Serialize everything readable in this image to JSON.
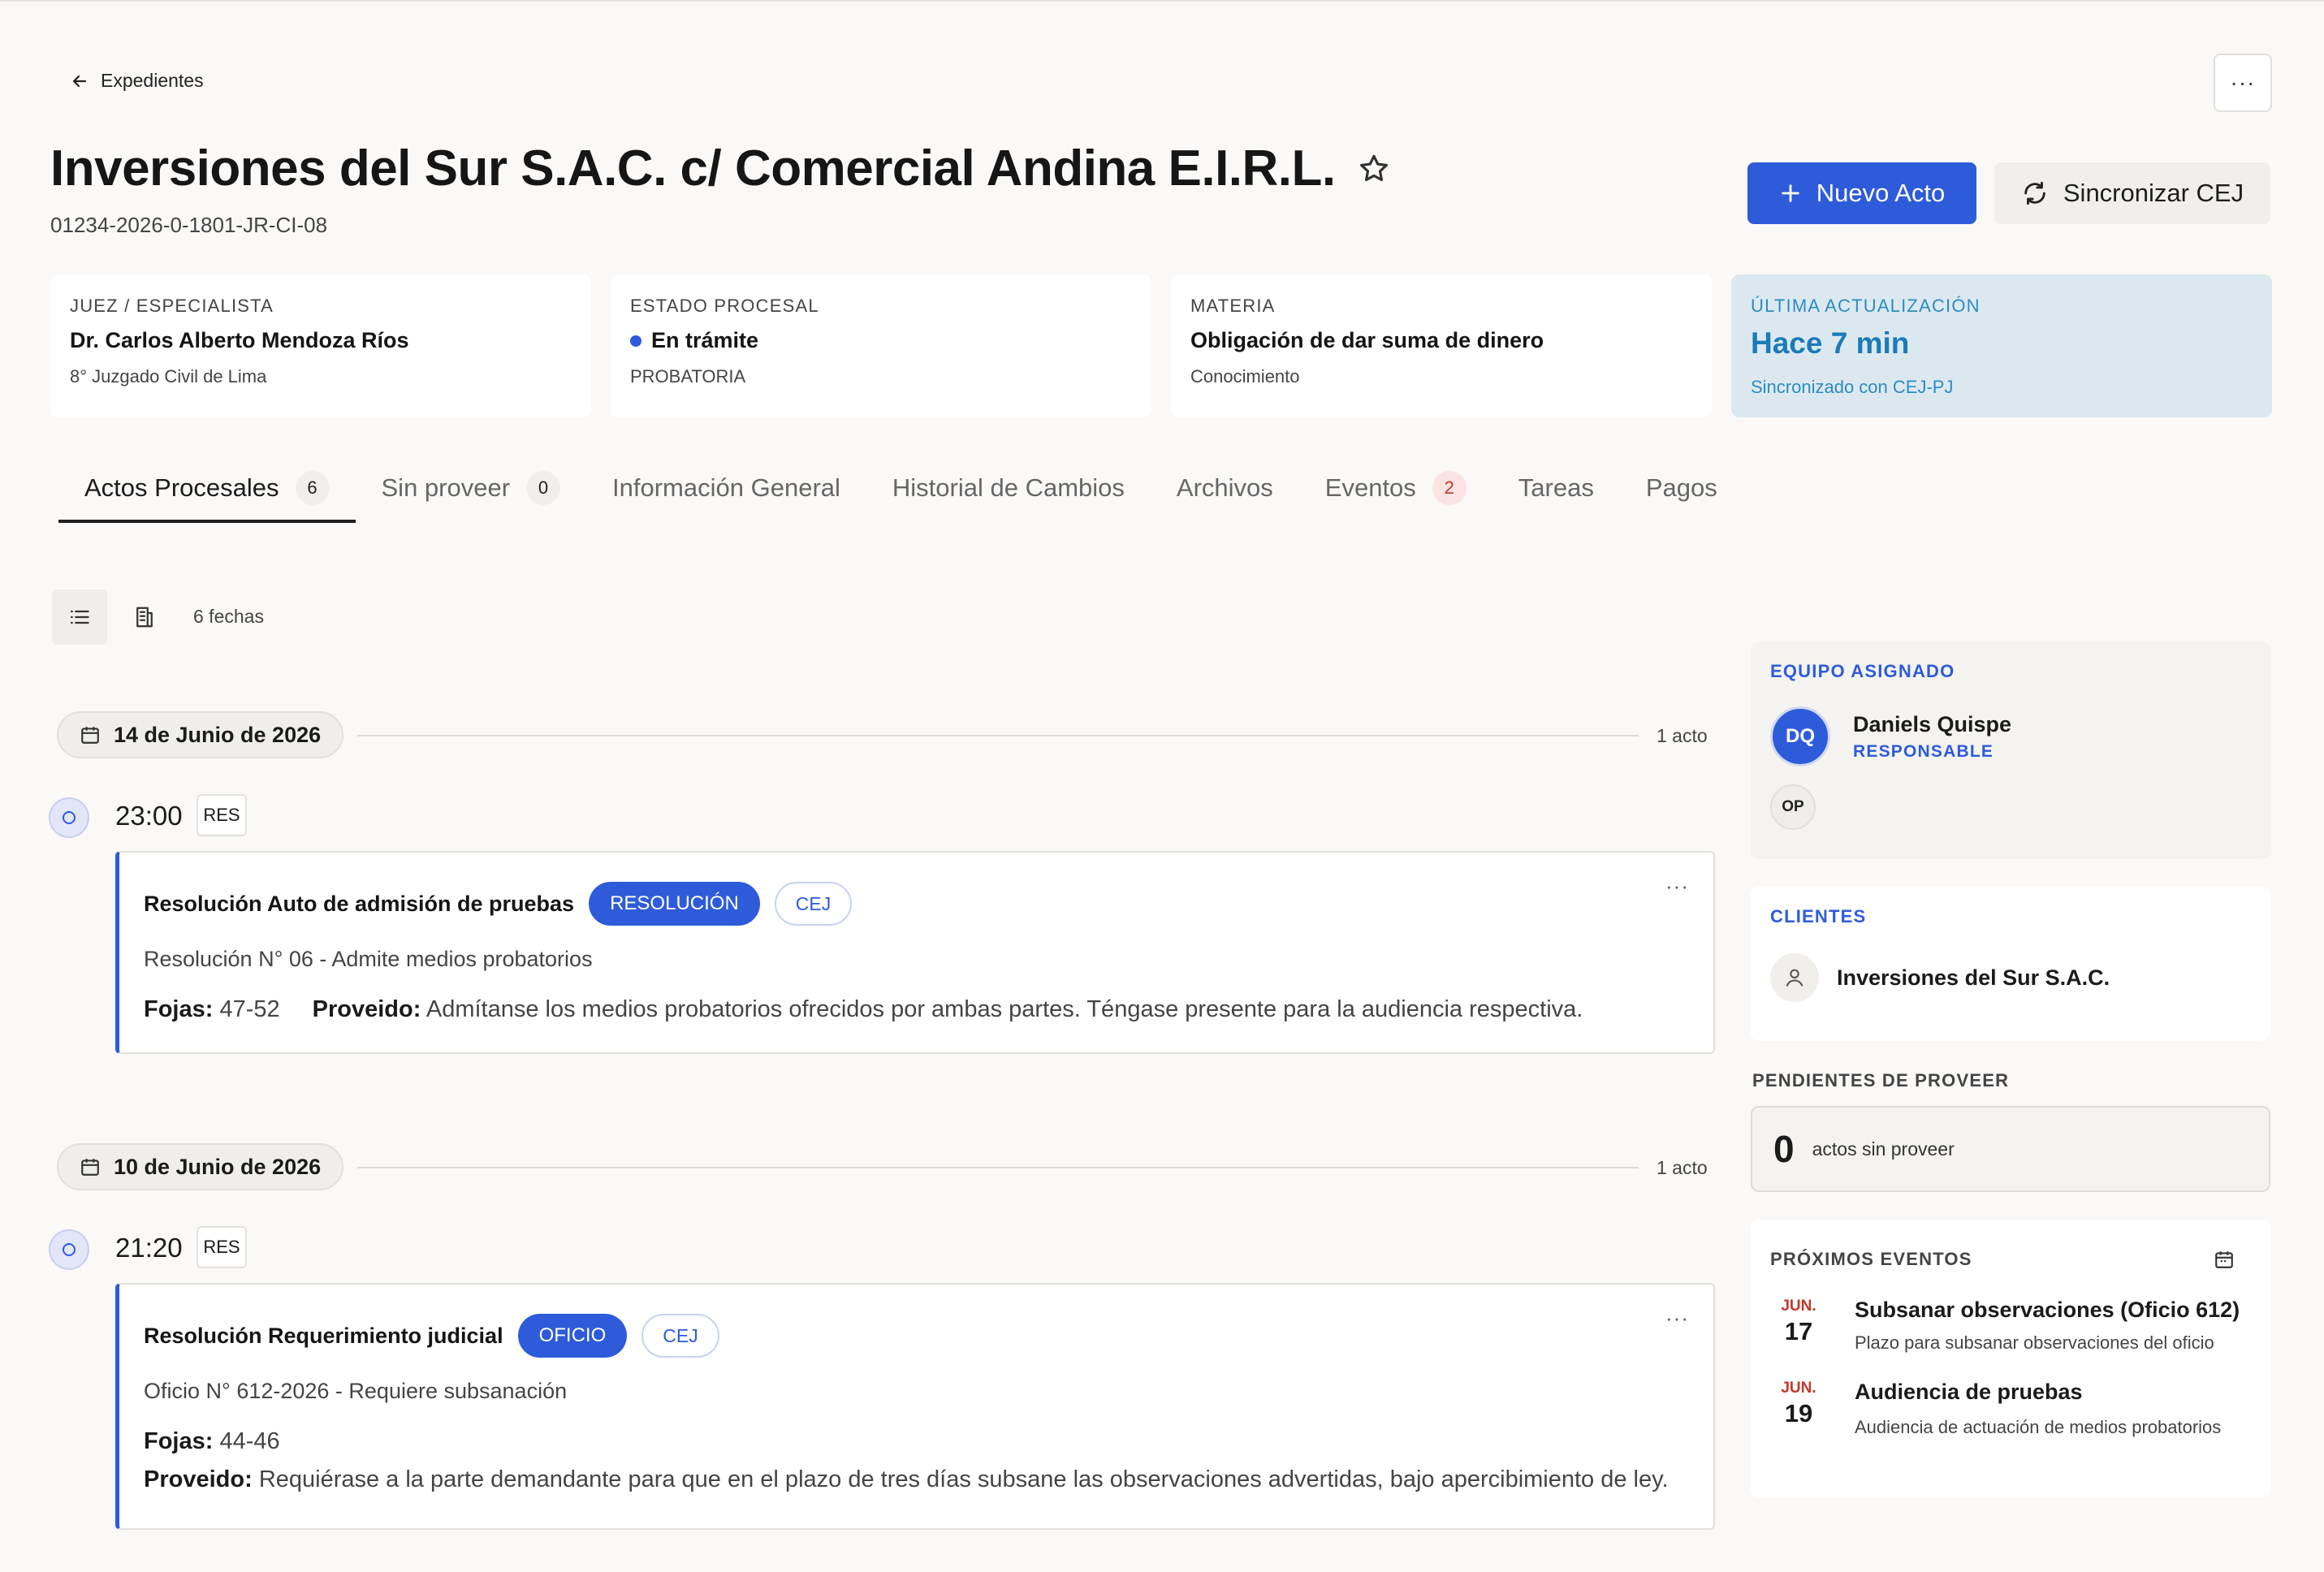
{
  "header": {
    "back_label": "Expedientes",
    "title": "Inversiones del Sur S.A.C. c/ Comercial Andina E.I.R.L.",
    "case_number": "01234-2026-0-1801-JR-CI-08",
    "more_label": "···",
    "new_act_label": "Nuevo Acto",
    "sync_label": "Sincronizar CEJ"
  },
  "info_cards": {
    "judge": {
      "label": "JUEZ / ESPECIALISTA",
      "value": "Dr. Carlos Alberto Mendoza Ríos",
      "sub": "8° Juzgado Civil de Lima"
    },
    "state": {
      "label": "ESTADO PROCESAL",
      "value": "En trámite",
      "sub": "PROBATORIA",
      "dot_color": "#2e5bd9"
    },
    "matter": {
      "label": "MATERIA",
      "value": "Obligación de dar suma de dinero",
      "sub": "Conocimiento"
    },
    "update": {
      "label": "ÚLTIMA ACTUALIZACIÓN",
      "value": "Hace 7 min",
      "sub": "Sincronizado con CEJ-PJ"
    }
  },
  "tabs": [
    {
      "label": "Actos Procesales",
      "badge": "6"
    },
    {
      "label": "Sin proveer",
      "badge": "0"
    },
    {
      "label": "Información General"
    },
    {
      "label": "Historial de Cambios"
    },
    {
      "label": "Archivos"
    },
    {
      "label": "Eventos",
      "badge": "2"
    },
    {
      "label": "Tareas"
    },
    {
      "label": "Pagos"
    }
  ],
  "toolbar": {
    "count_label": "6 fechas"
  },
  "timeline": [
    {
      "date": "14 de Junio de 2026",
      "count": "1 acto",
      "time": "23:00",
      "tag": "RES",
      "act": {
        "title": "Resolución Auto de admisión de pruebas",
        "type": "RESOLUCIÓN",
        "source": "CEJ",
        "subtitle": "Resolución N° 06 - Admite medios probatorios",
        "fojas_label": "Fojas:",
        "fojas": "47-52",
        "proveido_label": "Proveido:",
        "proveido": "Admítanse los medios probatorios ofrecidos por ambas partes. Téngase presente para la audiencia respectiva."
      }
    },
    {
      "date": "10 de Junio de 2026",
      "count": "1 acto",
      "time": "21:20",
      "tag": "RES",
      "act": {
        "title": "Resolución Requerimiento judicial",
        "type": "OFICIO",
        "source": "CEJ",
        "subtitle": "Oficio N° 612-2026 - Requiere subsanación",
        "fojas_label": "Fojas:",
        "fojas": "44-46",
        "proveido_label": "Proveido:",
        "proveido": "Requiérase a la parte demandante para que en el plazo de tres días subsane las observaciones advertidas, bajo apercibimiento de ley."
      }
    }
  ],
  "sidebar": {
    "team": {
      "label": "EQUIPO ASIGNADO",
      "members": [
        {
          "initials": "DQ",
          "name": "Daniels Quispe",
          "role": "RESPONSABLE"
        },
        {
          "initials": "OP"
        }
      ]
    },
    "clients": {
      "label": "CLIENTES",
      "items": [
        "Inversiones del Sur S.A.C."
      ]
    },
    "pending": {
      "label": "PENDIENTES DE PROVEER",
      "count": "0",
      "text": "actos sin proveer"
    },
    "events": {
      "label": "PRÓXIMOS EVENTOS",
      "items": [
        {
          "month": "JUN.",
          "day": "17",
          "title": "Subsanar observaciones (Oficio 612)",
          "desc": "Plazo para subsanar observaciones del oficio"
        },
        {
          "month": "JUN.",
          "day": "19",
          "title": "Audiencia de pruebas",
          "desc": "Audiencia de actuación de medios probatorios"
        }
      ]
    }
  },
  "colors": {
    "accent": "#2e5bd9",
    "update_card": "#dce8f0",
    "update_text": "#1a7bb8",
    "event_month": "#c0392b"
  }
}
